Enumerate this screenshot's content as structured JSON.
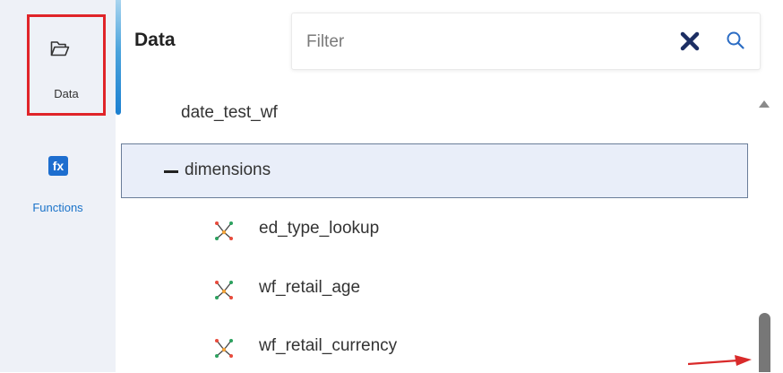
{
  "sidebar": {
    "items": [
      {
        "label": "Data",
        "icon": "folder-open-icon",
        "selected": true,
        "highlight_color": "#e02429"
      },
      {
        "label": "Functions",
        "icon": "fx-icon",
        "icon_text": "fx"
      }
    ]
  },
  "panel": {
    "title": "Data",
    "filter": {
      "placeholder": "Filter",
      "value": ""
    }
  },
  "tree": {
    "root": "date_test_wf",
    "folder": {
      "label": "dimensions",
      "expanded": true
    },
    "items": [
      {
        "label": "ed_type_lookup",
        "icon": "hierarchy-icon"
      },
      {
        "label": "wf_retail_age",
        "icon": "hierarchy-icon"
      },
      {
        "label": "wf_retail_currency",
        "icon": "hierarchy-icon"
      }
    ]
  },
  "colors": {
    "accent": "#1a7fd0",
    "sidebar_bg": "#eef1f7",
    "selected_row_bg": "#e9eef9",
    "clear_icon": "#1c2e63",
    "search_icon": "#2b6cc4",
    "annotation_arrow": "#d92a2a"
  }
}
